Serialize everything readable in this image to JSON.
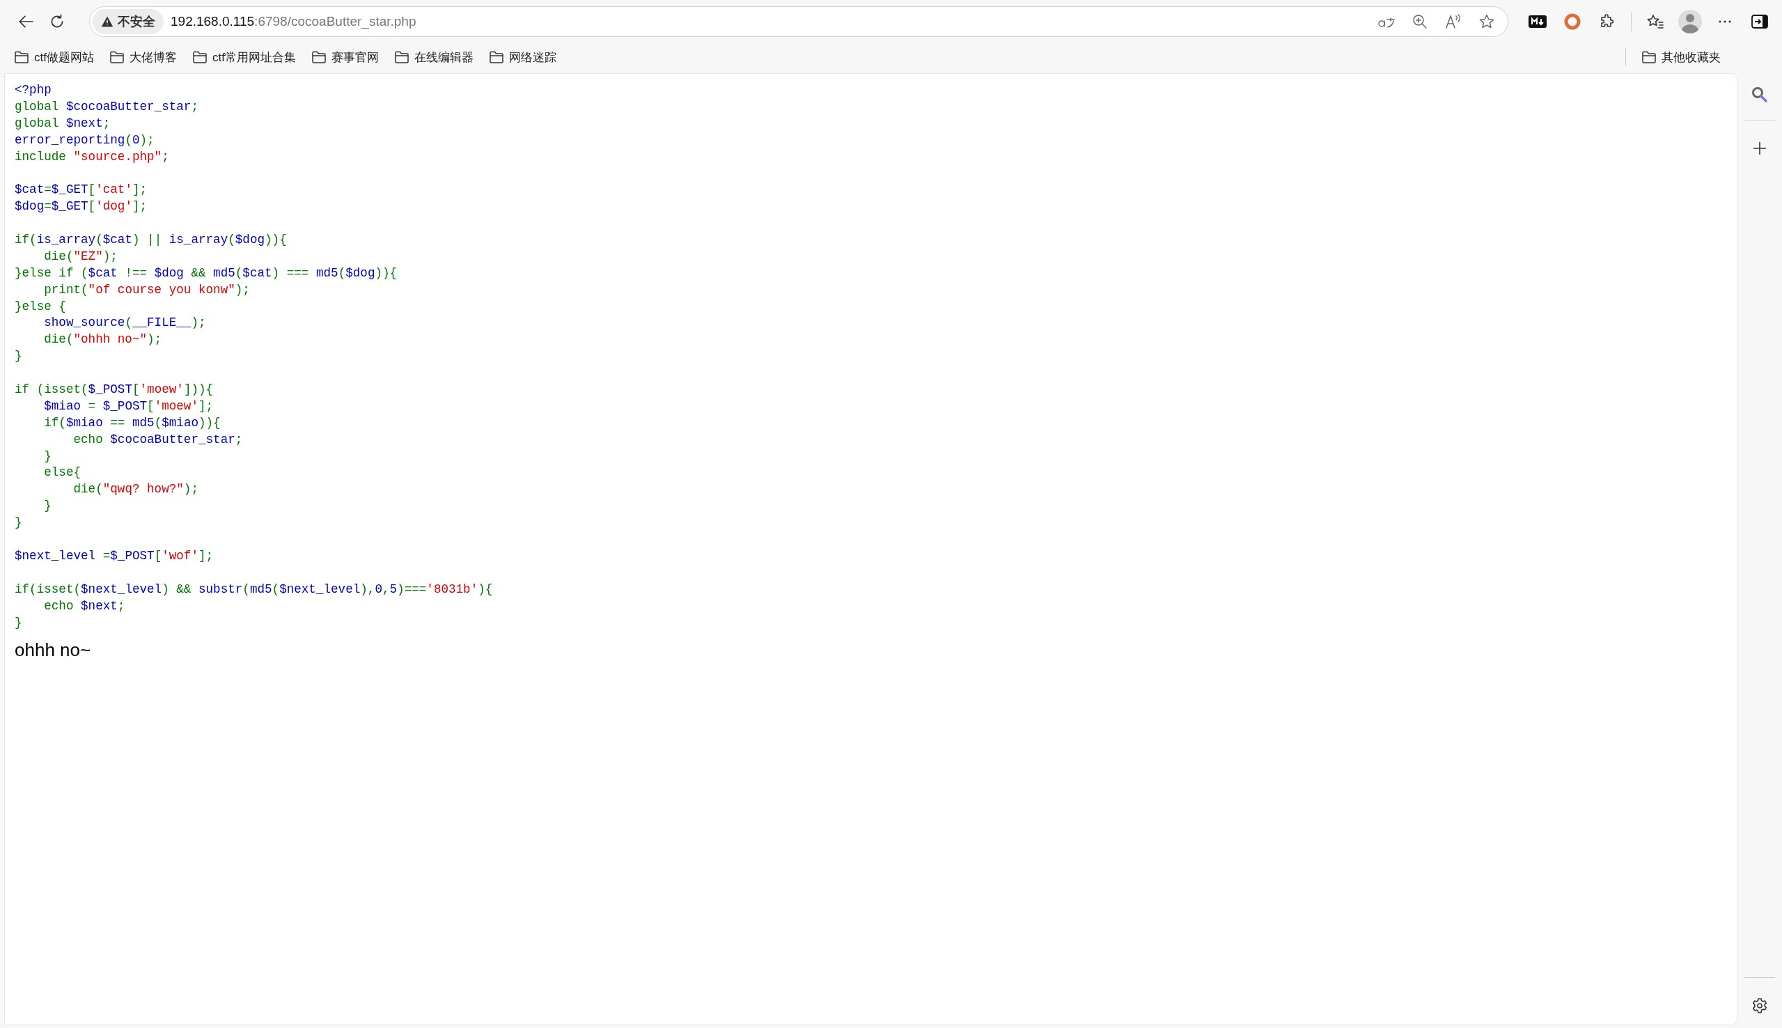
{
  "toolbar": {
    "security_label": "不安全",
    "url_host": "192.168.0.115",
    "url_rest": ":6798/cocoaButter_star.php"
  },
  "bookmarks": [
    {
      "label": "ctf做题网站"
    },
    {
      "label": "大佬博客"
    },
    {
      "label": "ctf常用网址合集"
    },
    {
      "label": "赛事官网"
    },
    {
      "label": "在线编辑器"
    },
    {
      "label": "网络迷踪"
    }
  ],
  "other_bookmarks": {
    "label": "其他收藏夹"
  },
  "code_blocks": [
    [
      [
        {
          "text": "<?php",
          "kind": "default"
        }
      ],
      [
        {
          "text": "global ",
          "kind": "keyword"
        },
        {
          "text": "$cocoaButter_star",
          "kind": "default"
        },
        {
          "text": ";",
          "kind": "keyword"
        }
      ],
      [
        {
          "text": "global ",
          "kind": "keyword"
        },
        {
          "text": "$next",
          "kind": "default"
        },
        {
          "text": ";",
          "kind": "keyword"
        }
      ],
      [
        {
          "text": "error_reporting",
          "kind": "default"
        },
        {
          "text": "(",
          "kind": "keyword"
        },
        {
          "text": "0",
          "kind": "default"
        },
        {
          "text": ");",
          "kind": "keyword"
        }
      ],
      [
        {
          "text": "include ",
          "kind": "keyword"
        },
        {
          "text": "\"source.php\"",
          "kind": "string"
        },
        {
          "text": ";",
          "kind": "keyword"
        }
      ]
    ],
    [
      [
        {
          "text": "$cat",
          "kind": "default"
        },
        {
          "text": "=",
          "kind": "keyword"
        },
        {
          "text": "$_GET",
          "kind": "default"
        },
        {
          "text": "[",
          "kind": "keyword"
        },
        {
          "text": "'cat'",
          "kind": "string"
        },
        {
          "text": "];",
          "kind": "keyword"
        }
      ],
      [
        {
          "text": "$dog",
          "kind": "default"
        },
        {
          "text": "=",
          "kind": "keyword"
        },
        {
          "text": "$_GET",
          "kind": "default"
        },
        {
          "text": "[",
          "kind": "keyword"
        },
        {
          "text": "'dog'",
          "kind": "string"
        },
        {
          "text": "];",
          "kind": "keyword"
        }
      ]
    ],
    [
      [
        {
          "text": "if(",
          "kind": "keyword"
        },
        {
          "text": "is_array",
          "kind": "default"
        },
        {
          "text": "(",
          "kind": "keyword"
        },
        {
          "text": "$cat",
          "kind": "default"
        },
        {
          "text": ") || ",
          "kind": "keyword"
        },
        {
          "text": "is_array",
          "kind": "default"
        },
        {
          "text": "(",
          "kind": "keyword"
        },
        {
          "text": "$dog",
          "kind": "default"
        },
        {
          "text": ")){",
          "kind": "keyword"
        }
      ],
      [
        {
          "text": "    die(",
          "kind": "keyword"
        },
        {
          "text": "\"EZ\"",
          "kind": "string"
        },
        {
          "text": ");",
          "kind": "keyword"
        }
      ],
      [
        {
          "text": "}else if (",
          "kind": "keyword"
        },
        {
          "text": "$cat ",
          "kind": "default"
        },
        {
          "text": "!== ",
          "kind": "keyword"
        },
        {
          "text": "$dog ",
          "kind": "default"
        },
        {
          "text": "&& ",
          "kind": "keyword"
        },
        {
          "text": "md5",
          "kind": "default"
        },
        {
          "text": "(",
          "kind": "keyword"
        },
        {
          "text": "$cat",
          "kind": "default"
        },
        {
          "text": ") === ",
          "kind": "keyword"
        },
        {
          "text": "md5",
          "kind": "default"
        },
        {
          "text": "(",
          "kind": "keyword"
        },
        {
          "text": "$dog",
          "kind": "default"
        },
        {
          "text": ")){",
          "kind": "keyword"
        }
      ],
      [
        {
          "text": "    print(",
          "kind": "keyword"
        },
        {
          "text": "\"of course you konw\"",
          "kind": "string"
        },
        {
          "text": ");",
          "kind": "keyword"
        }
      ],
      [
        {
          "text": "}else {",
          "kind": "keyword"
        }
      ],
      [
        {
          "text": "    show_source",
          "kind": "default"
        },
        {
          "text": "(",
          "kind": "keyword"
        },
        {
          "text": "__FILE__",
          "kind": "default"
        },
        {
          "text": ");",
          "kind": "keyword"
        }
      ],
      [
        {
          "text": "    die(",
          "kind": "keyword"
        },
        {
          "text": "\"ohhh no~\"",
          "kind": "string"
        },
        {
          "text": ");",
          "kind": "keyword"
        }
      ],
      [
        {
          "text": "}",
          "kind": "keyword"
        }
      ]
    ],
    [
      [
        {
          "text": "if (isset(",
          "kind": "keyword"
        },
        {
          "text": "$_POST",
          "kind": "default"
        },
        {
          "text": "[",
          "kind": "keyword"
        },
        {
          "text": "'moew'",
          "kind": "string"
        },
        {
          "text": "])){",
          "kind": "keyword"
        }
      ],
      [
        {
          "text": "    $miao ",
          "kind": "default"
        },
        {
          "text": "= ",
          "kind": "keyword"
        },
        {
          "text": "$_POST",
          "kind": "default"
        },
        {
          "text": "[",
          "kind": "keyword"
        },
        {
          "text": "'moew'",
          "kind": "string"
        },
        {
          "text": "];",
          "kind": "keyword"
        }
      ],
      [
        {
          "text": "    if(",
          "kind": "keyword"
        },
        {
          "text": "$miao ",
          "kind": "default"
        },
        {
          "text": "== ",
          "kind": "keyword"
        },
        {
          "text": "md5",
          "kind": "default"
        },
        {
          "text": "(",
          "kind": "keyword"
        },
        {
          "text": "$miao",
          "kind": "default"
        },
        {
          "text": ")){",
          "kind": "keyword"
        }
      ],
      [
        {
          "text": "        echo ",
          "kind": "keyword"
        },
        {
          "text": "$cocoaButter_star",
          "kind": "default"
        },
        {
          "text": ";",
          "kind": "keyword"
        }
      ],
      [
        {
          "text": "    }",
          "kind": "keyword"
        }
      ],
      [
        {
          "text": "    else{",
          "kind": "keyword"
        }
      ],
      [
        {
          "text": "        die(",
          "kind": "keyword"
        },
        {
          "text": "\"qwq? how?\"",
          "kind": "string"
        },
        {
          "text": ");",
          "kind": "keyword"
        }
      ],
      [
        {
          "text": "    }",
          "kind": "keyword"
        }
      ],
      [
        {
          "text": "}",
          "kind": "keyword"
        }
      ]
    ],
    [
      [
        {
          "text": "$next_level ",
          "kind": "default"
        },
        {
          "text": "=",
          "kind": "keyword"
        },
        {
          "text": "$_POST",
          "kind": "default"
        },
        {
          "text": "[",
          "kind": "keyword"
        },
        {
          "text": "'wof'",
          "kind": "string"
        },
        {
          "text": "];",
          "kind": "keyword"
        }
      ]
    ],
    [
      [
        {
          "text": "if(isset(",
          "kind": "keyword"
        },
        {
          "text": "$next_level",
          "kind": "default"
        },
        {
          "text": ") && ",
          "kind": "keyword"
        },
        {
          "text": "substr",
          "kind": "default"
        },
        {
          "text": "(",
          "kind": "keyword"
        },
        {
          "text": "md5",
          "kind": "default"
        },
        {
          "text": "(",
          "kind": "keyword"
        },
        {
          "text": "$next_level",
          "kind": "default"
        },
        {
          "text": "),",
          "kind": "keyword"
        },
        {
          "text": "0",
          "kind": "default"
        },
        {
          "text": ",",
          "kind": "keyword"
        },
        {
          "text": "5",
          "kind": "default"
        },
        {
          "text": ")===",
          "kind": "keyword"
        },
        {
          "text": "'8031b'",
          "kind": "string"
        },
        {
          "text": "){",
          "kind": "keyword"
        }
      ],
      [
        {
          "text": "    echo ",
          "kind": "keyword"
        },
        {
          "text": "$next",
          "kind": "default"
        },
        {
          "text": ";",
          "kind": "keyword"
        }
      ],
      [
        {
          "text": "}",
          "kind": "keyword"
        }
      ]
    ]
  ],
  "output": "ohhh no~"
}
